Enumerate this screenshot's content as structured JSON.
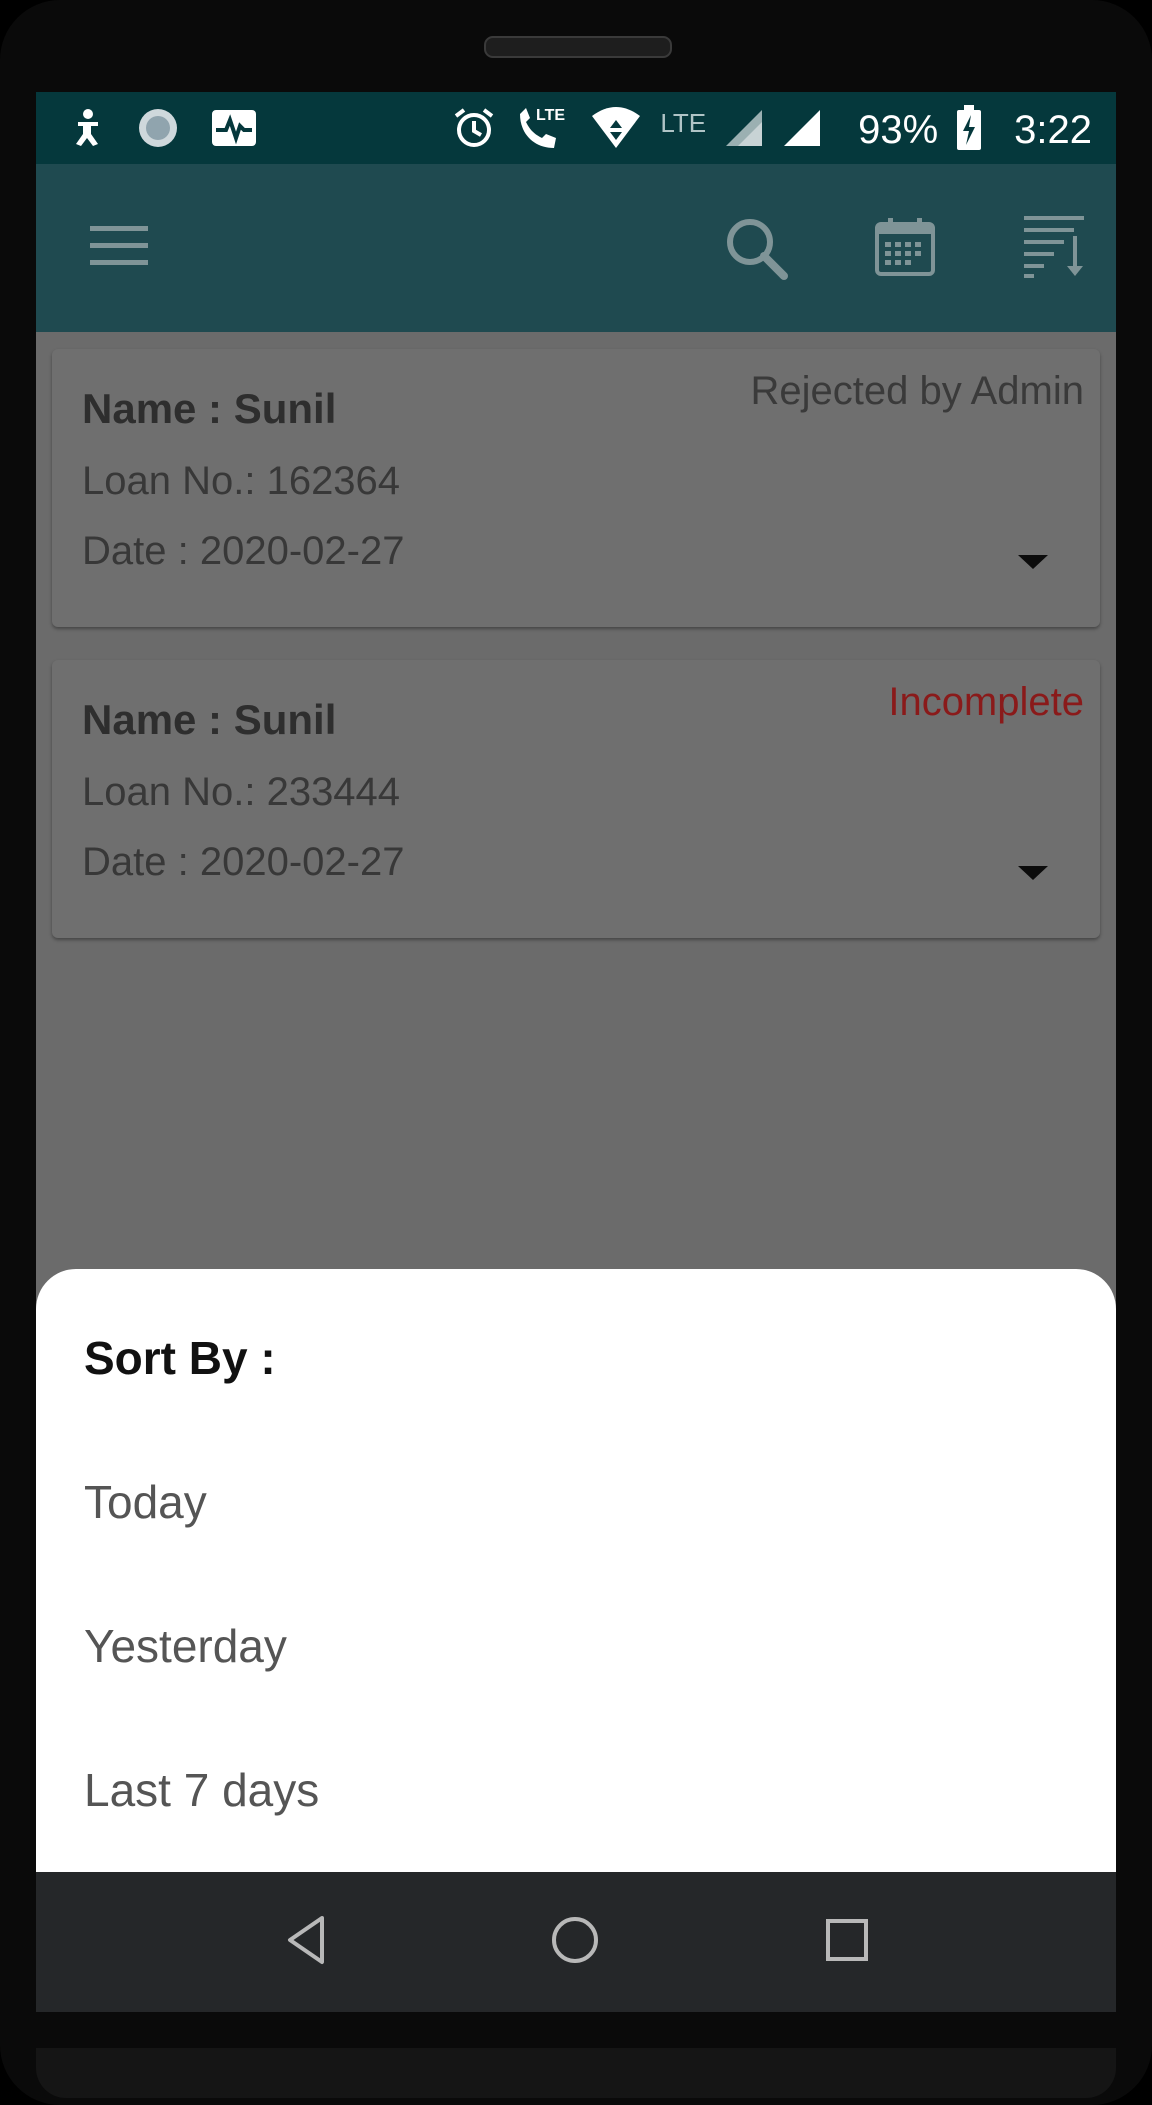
{
  "status_bar": {
    "left_icons": [
      "accessibility-icon",
      "photo-icon",
      "activity-icon"
    ],
    "right_icons": [
      "alarm-icon",
      "volte-call-icon",
      "wifi-icon",
      "signal-icon"
    ],
    "lte_label": "LTE",
    "battery": "93%",
    "time": "3:22"
  },
  "app_bar": {
    "icons": [
      "menu-icon",
      "search-icon",
      "calendar-icon",
      "sort-icon"
    ]
  },
  "loans": [
    {
      "name": "Name : Sunil",
      "loan_no": "Loan No.: 162364",
      "date": "Date : 2020-02-27",
      "status": "Rejected by Admin",
      "status_color": "#3a3a3a"
    },
    {
      "name": "Name : Sunil",
      "loan_no": "Loan No.: 233444",
      "date": "Date : 2020-02-27",
      "status": "Incomplete",
      "status_color": "#8a1a1a"
    }
  ],
  "sort_sheet": {
    "title": "Sort By :",
    "options": [
      "Today",
      "Yesterday",
      "Last 7 days"
    ]
  },
  "nav_bar": {
    "icons": [
      "back-icon",
      "home-icon",
      "recents-icon"
    ]
  },
  "colors": {
    "status_bar": "#05383c",
    "app_bar": "#1f4a50",
    "scrim": "#6b6b6b"
  }
}
